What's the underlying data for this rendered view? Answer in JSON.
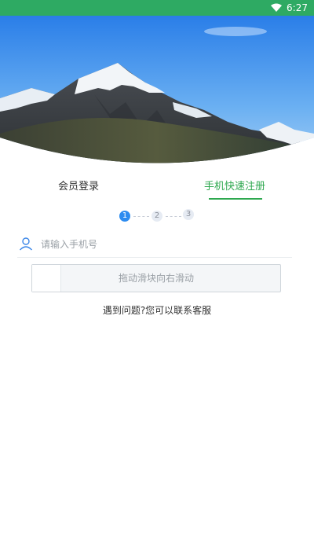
{
  "status_bar": {
    "time": "6:27",
    "icons": [
      "wifi-icon"
    ],
    "background": "#2eaa63"
  },
  "tabs": {
    "login": "会员登录",
    "register": "手机快速注册",
    "active": "register",
    "accent": "#2ea84f"
  },
  "steps": [
    "1",
    "2",
    "3"
  ],
  "form": {
    "phone_placeholder": "请输入手机号",
    "phone_value": ""
  },
  "slider": {
    "label": "拖动滑块向右滑动"
  },
  "help": {
    "text": "遇到问题?您可以联系客服"
  }
}
